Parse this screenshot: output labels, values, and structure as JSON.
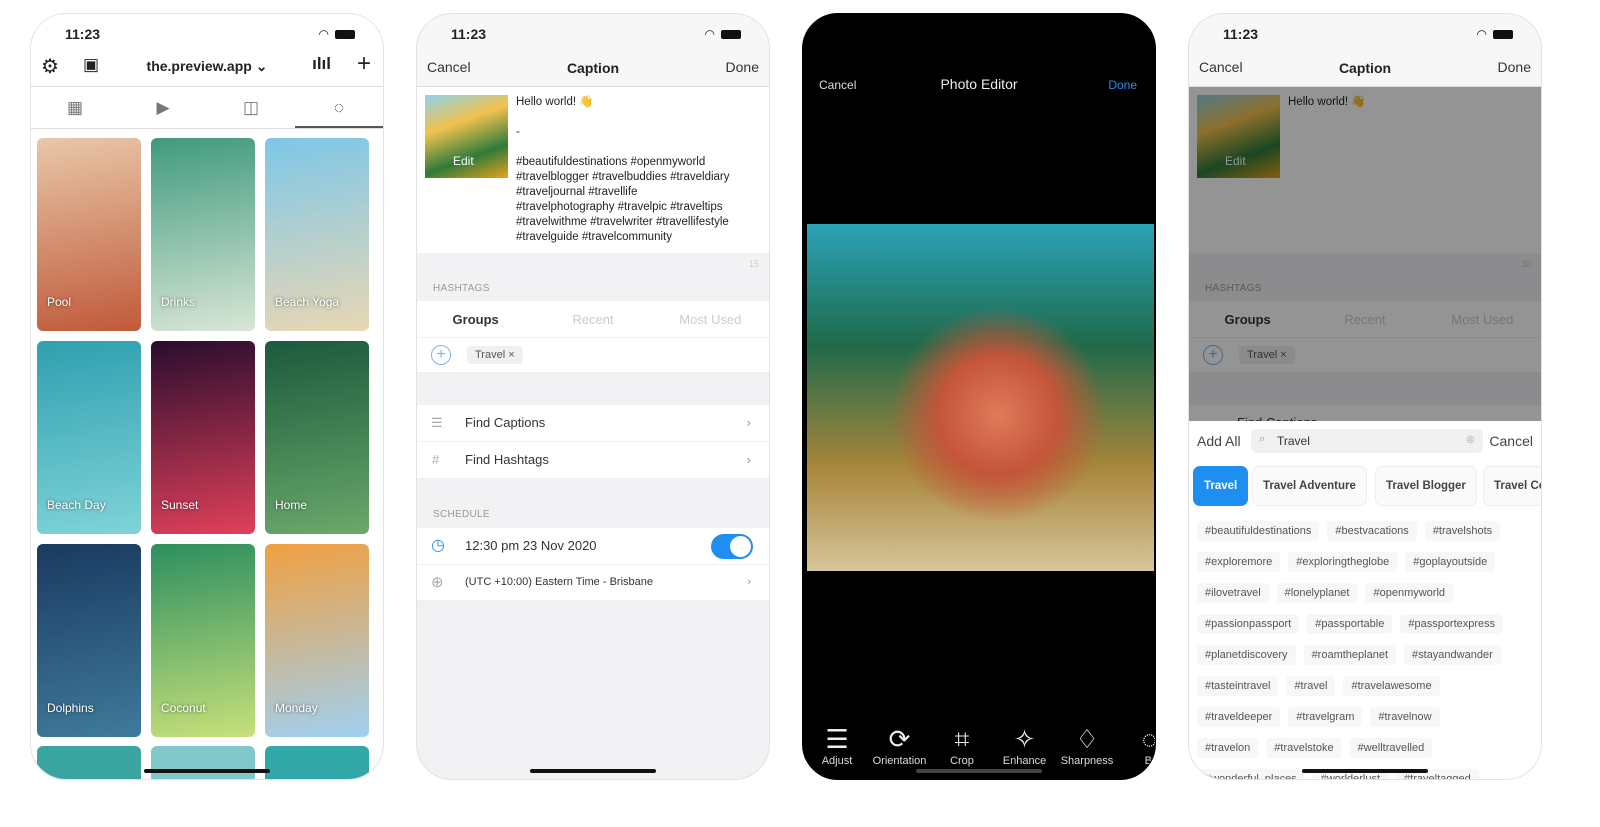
{
  "status_time": "11:23",
  "feed": {
    "account": "the.preview.app",
    "tiles": [
      "Pool",
      "Drinks",
      "Beach Yoga",
      "Beach Day",
      "Sunset",
      "Home",
      "Dolphins",
      "Coconut",
      "Monday"
    ],
    "tile_colors": [
      [
        "#e8c7a8",
        "#c05a3a"
      ],
      [
        "#3f9a7e",
        "#d9e6d6"
      ],
      [
        "#7ec7e8",
        "#e8d7b4"
      ],
      [
        "#2f9fb0",
        "#7fd4d8"
      ],
      [
        "#2a0d2e",
        "#e0405a"
      ],
      [
        "#1b5a3d",
        "#6aa86a"
      ],
      [
        "#1a3a60",
        "#3f7a9c"
      ],
      [
        "#2d8f5f",
        "#c6e07a"
      ],
      [
        "#f0a040",
        "#a0d0f0"
      ]
    ]
  },
  "caption_screen": {
    "cancel": "Cancel",
    "title": "Caption",
    "done": "Done",
    "edit": "Edit",
    "caption": "Hello world! 👋\n\n-\n\n#beautifuldestinations #openmyworld\n#travelblogger #travelbuddies #traveldiary\n#traveljournal #travellife\n#travelphotography #travelpic #traveltips\n#travelwithme #travelwriter #travellifestyle\n#travelguide #travelcommunity",
    "count": "15",
    "hashtags_label": "HASHTAGS",
    "segments": [
      "Groups",
      "Recent",
      "Most Used"
    ],
    "chip": "Travel",
    "find_captions": "Find Captions",
    "find_hashtags": "Find Hashtags",
    "schedule_label": "SCHEDULE",
    "schedule_time": "12:30 pm  23 Nov 2020",
    "schedule_enabled": true,
    "timezone": "(UTC +10:00) Eastern Time - Brisbane"
  },
  "editor": {
    "cancel": "Cancel",
    "title": "Photo Editor",
    "done": "Done",
    "tools": [
      "Adjust",
      "Orientation",
      "Crop",
      "Enhance",
      "Sharpness",
      "Bl"
    ]
  },
  "picker": {
    "cancel_nav": "Cancel",
    "title": "Caption",
    "done": "Done",
    "caption_first": "Hello world! 👋",
    "count": "30",
    "find_captions": "Find Captions",
    "add_all": "Add All",
    "search_value": "Travel",
    "cancel": "Cancel",
    "groups": [
      "Travel",
      "Travel Adventure",
      "Travel Blogger",
      "Travel Co"
    ],
    "tag_rows": [
      [
        "#beautifuldestinations",
        "#bestvacations",
        "#travelshots"
      ],
      [
        "#exploremore",
        "#exploringtheglobe",
        "#goplayoutside"
      ],
      [
        "#ilovetravel",
        "#lonelyplanet",
        "#openmyworld"
      ],
      [
        "#passionpassport",
        "#passportable",
        "#passportexpress"
      ],
      [
        "#planetdiscovery",
        "#roamtheplanet",
        "#stayandwander"
      ],
      [
        "#tasteintravel",
        "#travel",
        "#travelawesome"
      ],
      [
        "#traveldeeper",
        "#travelgram",
        "#travelnow"
      ],
      [
        "#travelon",
        "#travelstoke",
        "#welltravelled"
      ],
      [
        "#wonderful_places",
        "#worlderlust",
        "#traveltagged"
      ]
    ]
  },
  "colors": {
    "accent": "#1e8ff0"
  }
}
